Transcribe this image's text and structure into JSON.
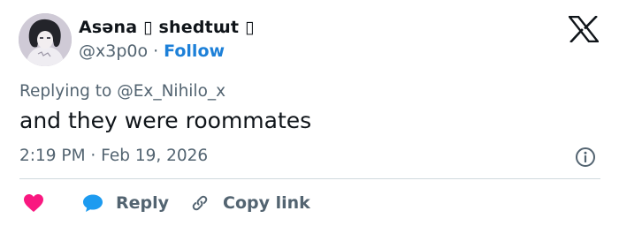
{
  "author": {
    "display_name": "Asəna ▯ shedtɯt ▯",
    "handle": "@x3p0o",
    "separator": "·",
    "follow_label": "Follow"
  },
  "reply_context": {
    "prefix": "Replying to",
    "mention": "@Ex_Nihilo_x"
  },
  "tweet": {
    "text": "and they were roommates",
    "timestamp": "2:19 PM · Feb 19, 2026"
  },
  "actions": {
    "reply_label": "Reply",
    "copy_link_label": "Copy link"
  },
  "icons": {
    "brand": "x-logo-icon",
    "info": "info-icon",
    "like": "heart-icon",
    "reply": "chat-bubble-icon",
    "copy": "link-icon"
  },
  "colors": {
    "heart": "#f91880",
    "reply_bubble": "#1d9bf0",
    "follow": "#1d80d8",
    "secondary_text": "#536471",
    "primary_text": "#0f1419"
  }
}
